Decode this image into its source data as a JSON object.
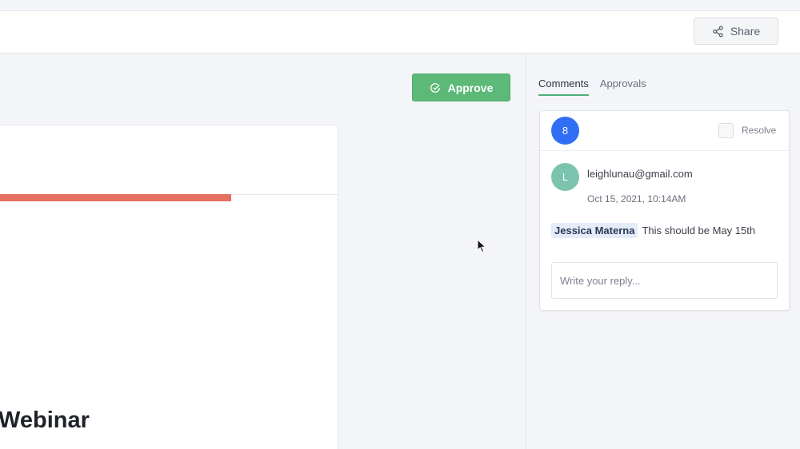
{
  "header": {
    "share_label": "Share",
    "share_icon": "share-icon"
  },
  "main": {
    "approve_label": "Approve",
    "approve_icon": "check-circle-icon",
    "document": {
      "heading": "Webinar",
      "accent_color": "#e4705f"
    }
  },
  "sidebar": {
    "tabs": [
      {
        "label": "Comments",
        "active": true
      },
      {
        "label": "Approvals",
        "active": false
      }
    ],
    "comment_thread": {
      "count": "8",
      "resolve_label": "Resolve",
      "resolved": false,
      "comment": {
        "avatar_initial": "L",
        "author": "leighlunau@gmail.com",
        "timestamp": "Oct 15, 2021, 10:14AM",
        "mention": "Jessica Materna",
        "text": "This should be May 15th"
      },
      "reply_placeholder": "Write your reply...",
      "reply_value": ""
    }
  },
  "colors": {
    "approve_green": "#5cb978",
    "badge_blue": "#2f6ef5",
    "avatar_teal": "#7cc3ad",
    "tab_underline": "#4caf7a"
  }
}
